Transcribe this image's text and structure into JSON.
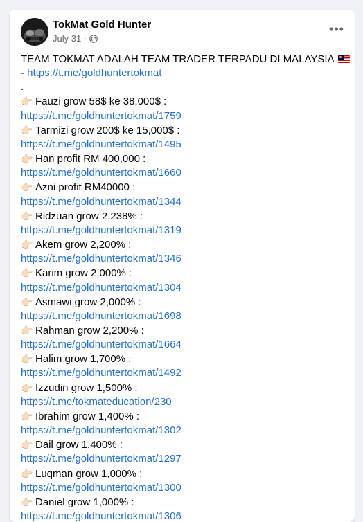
{
  "post": {
    "author": "TokMat Gold Hunter",
    "date": "July 31",
    "separator": "·",
    "more_label": "•••",
    "headline": "TEAM TOKMAT ADALAH TEAM TRADER TERPADU DI MALAYSIA",
    "headline_flag": "malaysia-flag",
    "intro_prefix": "- ",
    "intro_link": "https://t.me/goldhuntertokmat",
    "dot_line": ".",
    "hand_icon": "👉🏻",
    "entries": [
      {
        "label": "Fauzi grow 58$ ke 38,000$ :",
        "link": "https://t.me/goldhuntertokmat/1759"
      },
      {
        "label": "Tarmizi grow 200$ ke 15,000$ :",
        "link": "https://t.me/goldhuntertokmat/1495"
      },
      {
        "label": "Han profit RM 400,000 :",
        "link": "https://t.me/goldhuntertokmat/1660"
      },
      {
        "label": "Azni profit RM40000 :",
        "link": "https://t.me/goldhuntertokmat/1344"
      },
      {
        "label": "Ridzuan grow 2,238% :",
        "link": "https://t.me/goldhuntertokmat/1319"
      },
      {
        "label": "Akem grow 2,200% :",
        "link": "https://t.me/goldhuntertokmat/1346"
      },
      {
        "label": "Karim grow 2,000% :",
        "link": "https://t.me/goldhuntertokmat/1304"
      },
      {
        "label": "Asmawi grow 2,000% :",
        "link": "https://t.me/goldhuntertokmat/1698"
      },
      {
        "label": "Rahman grow 2,200% :",
        "link": "https://t.me/goldhuntertokmat/1664"
      },
      {
        "label": "Halim grow 1,700% :",
        "link": "https://t.me/goldhuntertokmat/1492"
      },
      {
        "label": "Izzudin grow 1,500% :",
        "link": "https://t.me/tokmateducation/230"
      },
      {
        "label": "Ibrahim grow 1,400% :",
        "link": "https://t.me/goldhuntertokmat/1302"
      },
      {
        "label": "Dail grow 1,400% :",
        "link": "https://t.me/goldhuntertokmat/1297"
      },
      {
        "label": "Luqman grow 1,000% :",
        "link": "https://t.me/goldhuntertokmat/1300"
      },
      {
        "label": "Daniel grow 1,000% :",
        "link": "https://t.me/goldhuntertokmat/1306"
      }
    ]
  },
  "colors": {
    "page_bg": "#f0f2f5",
    "card_bg": "#ffffff",
    "text": "#050505",
    "muted": "#65676b",
    "link": "#216fdb"
  }
}
